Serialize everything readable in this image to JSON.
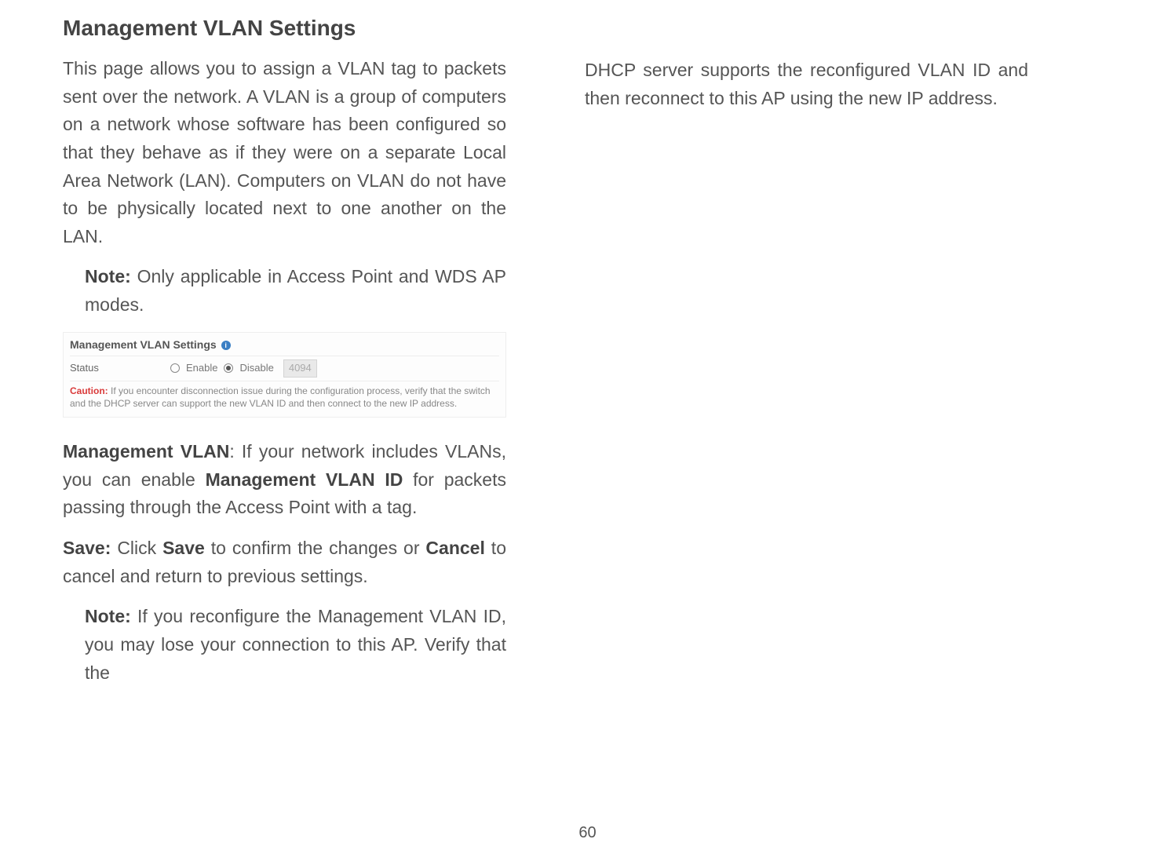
{
  "heading": "Management VLAN Settings",
  "col1": {
    "p1": "This page allows you to assign a VLAN tag to packets sent over the network. A VLAN is a group of computers on a network whose software has been configured so that they behave as if they were on a separate Local Area Network (LAN). Computers on VLAN do not have to be physically located next to one another on the LAN.",
    "note1_label": "Note:",
    "note1_text": " Only applicable in Access Point and WDS AP modes.",
    "shot": {
      "title": "Management VLAN Settings",
      "status_label": "Status",
      "enable": "Enable",
      "disable": "Disable",
      "vlan_value": "4094",
      "caution_label": "Caution:",
      "caution_text": "If you encounter disconnection issue during the configuration process, verify that the switch and the DHCP server can support the new VLAN ID and then connect to the new IP address."
    },
    "p2_b1": "Management VLAN",
    "p2_t1": ": If your network includes VLANs, you can enable ",
    "p2_b2": "Management VLAN ID",
    "p2_t2": " for packets passing through the Access Point with a tag.",
    "p3_b1": "Save:",
    "p3_t1": " Click ",
    "p3_b2": "Save",
    "p3_t2": " to confirm the changes or ",
    "p3_b3": "Cancel",
    "p3_t3": " to cancel and return to previous settings.",
    "note2_label": "Note:",
    "note2_text": " If you reconfigure the Management VLAN ID, you may lose your connection to this AP. Verify that the"
  },
  "col2": {
    "p1": "DHCP server supports the reconfigured VLAN ID and then reconnect to this AP using the new IP address."
  },
  "page": "60"
}
